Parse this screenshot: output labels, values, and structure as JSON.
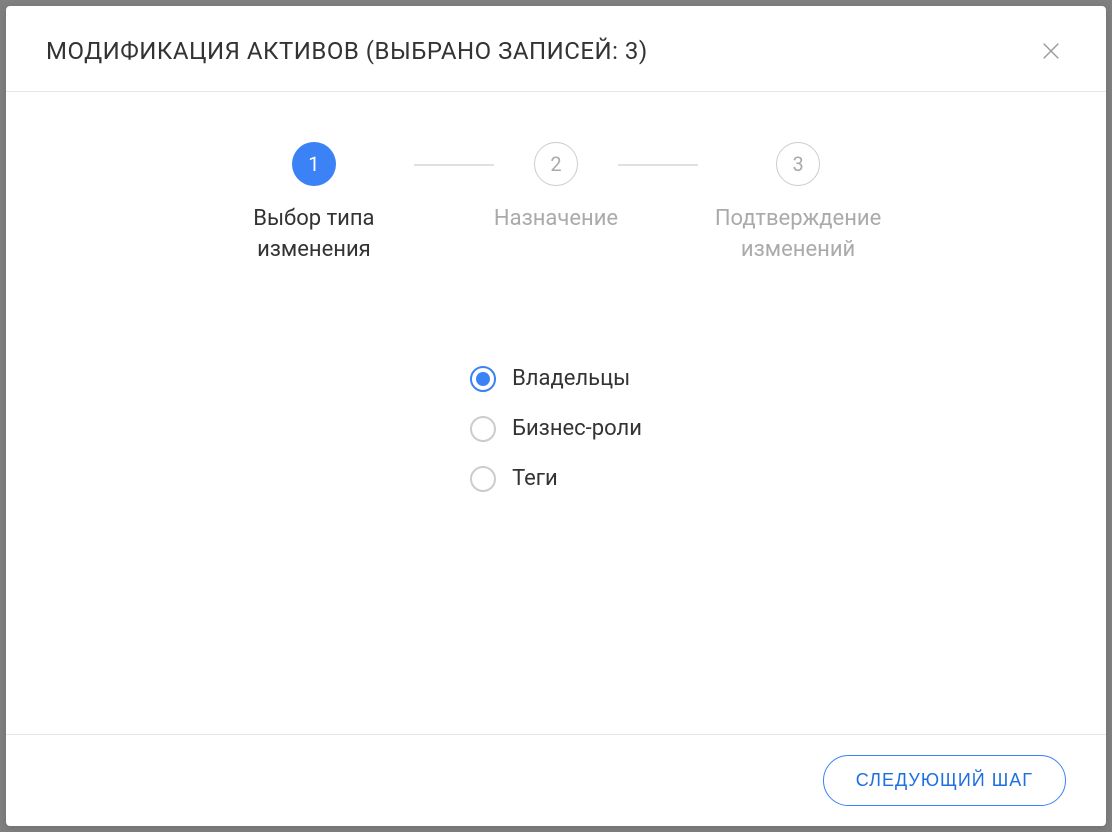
{
  "header": {
    "title": "МОДИФИКАЦИЯ АКТИВОВ (ВЫБРАНО ЗАПИСЕЙ: 3)"
  },
  "stepper": {
    "steps": [
      {
        "num": "1",
        "label": "Выбор типа изменения",
        "active": true
      },
      {
        "num": "2",
        "label": "Назначение",
        "active": false
      },
      {
        "num": "3",
        "label": "Подтверждение изменений",
        "active": false
      }
    ]
  },
  "radios": {
    "options": [
      {
        "label": "Владельцы",
        "selected": true
      },
      {
        "label": "Бизнес-роли",
        "selected": false
      },
      {
        "label": "Теги",
        "selected": false
      }
    ]
  },
  "footer": {
    "next_label": "СЛЕДУЮЩИЙ ШАГ"
  }
}
